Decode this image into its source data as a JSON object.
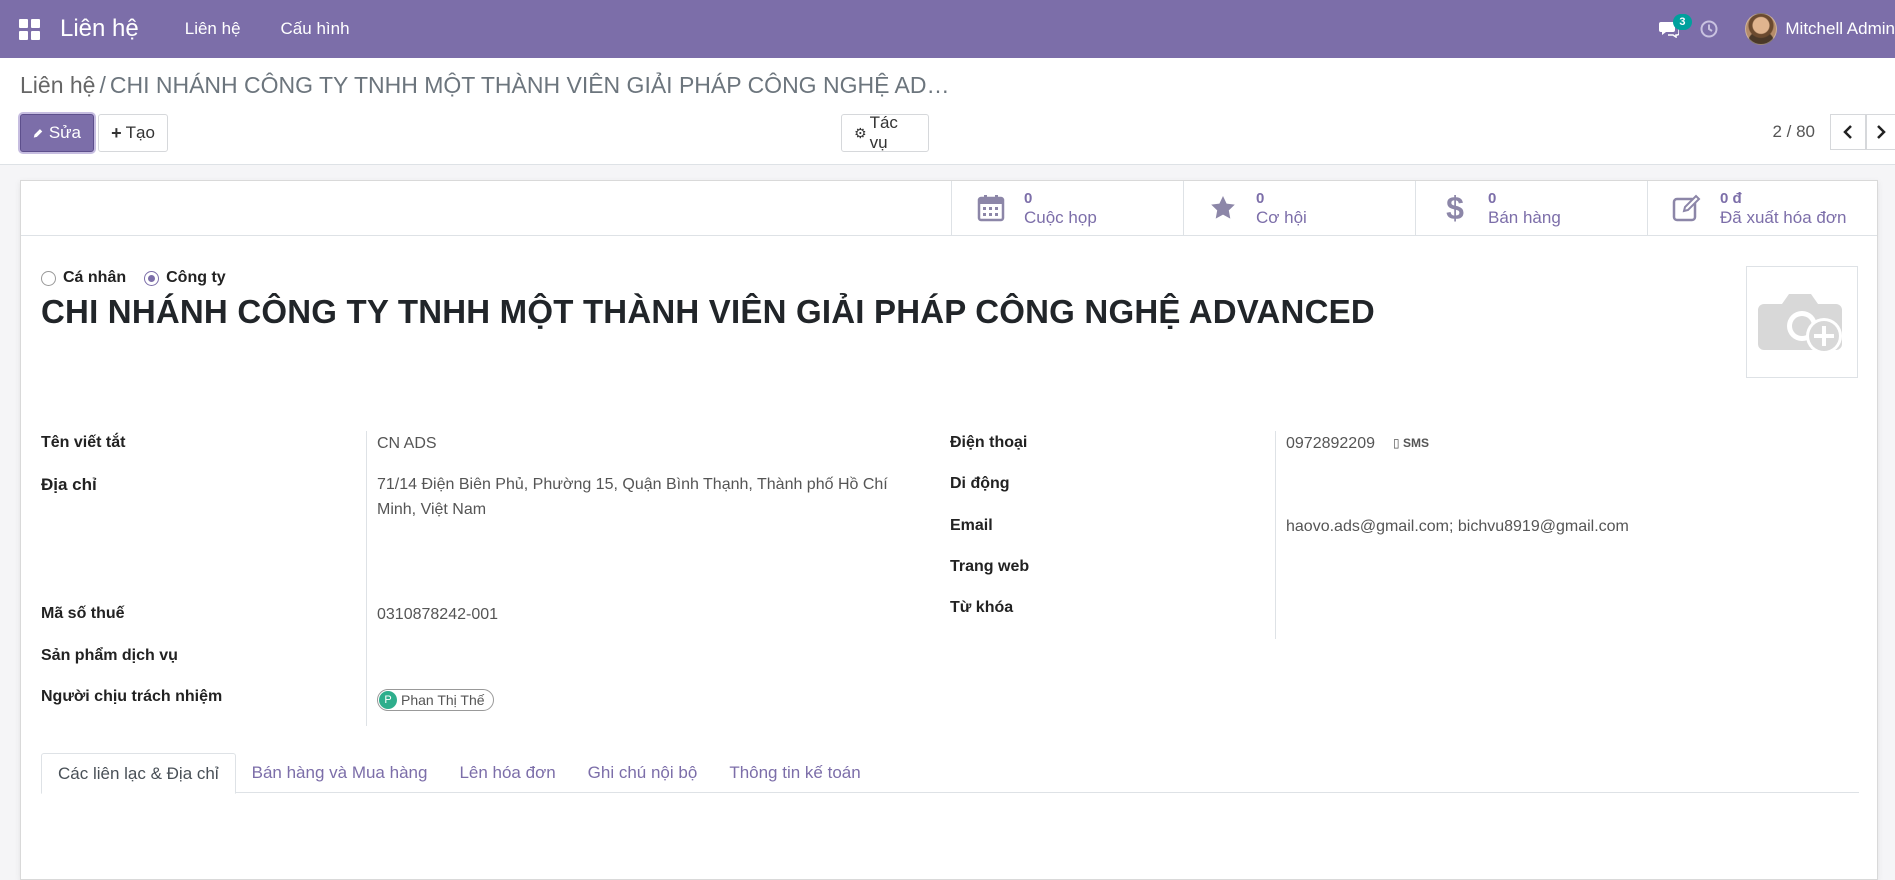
{
  "navbar": {
    "app_title": "Liên hệ",
    "menus": [
      "Liên hệ",
      "Cấu hình"
    ],
    "message_count": "3",
    "user_name": "Mitchell Admin"
  },
  "breadcrumb": {
    "parent": "Liên hệ",
    "separator": "/",
    "current": "CHI NHÁNH CÔNG TY TNHH MỘT THÀNH VIÊN GIẢI PHÁP CÔNG NGHỆ AD…"
  },
  "toolbar": {
    "edit_label": "Sửa",
    "create_label": "Tạo",
    "action_label": "Tác vụ",
    "pager": "2 / 80"
  },
  "smart_buttons": [
    {
      "value": "0",
      "label": "Cuộc họp",
      "icon": "calendar-icon"
    },
    {
      "value": "0",
      "label": "Cơ hội",
      "icon": "star-icon"
    },
    {
      "value": "0",
      "label": "Bán hàng",
      "icon": "dollar-icon"
    },
    {
      "value": "0 đ",
      "label": "Đã xuất hóa đơn",
      "icon": "edit-icon"
    }
  ],
  "company_type": {
    "individual_label": "Cá nhân",
    "company_label": "Công ty",
    "selected": "Công ty"
  },
  "record_title": "CHI NHÁNH CÔNG TY TNHH MỘT THÀNH VIÊN GIẢI PHÁP CÔNG NGHỆ ADVANCED",
  "left_fields": {
    "short_name_label": "Tên viết tắt",
    "short_name_value": "CN ADS",
    "address_label": "Địa chỉ",
    "address_value": "71/14 Điện Biên Phủ, Phường 15, Quận Bình Thạnh, Thành phố Hồ Chí Minh, Việt Nam",
    "tax_label": "Mã số thuế",
    "tax_value": "0310878242-001",
    "service_label": "Sản phẩm dịch vụ",
    "responsible_label": "Người chịu trách nhiệm",
    "responsible_initial": "P",
    "responsible_value": "Phan Thị Thế"
  },
  "right_fields": {
    "phone_label": "Điện thoại",
    "phone_value": "0972892209",
    "sms_label": "SMS",
    "mobile_label": "Di động",
    "email_label": "Email",
    "email_value": "haovo.ads@gmail.com; bichvu8919@gmail.com",
    "website_label": "Trang web",
    "tags_label": "Từ khóa"
  },
  "tabs": [
    "Các liên lạc & Địa chỉ",
    "Bán hàng và Mua hàng",
    "Lên hóa đơn",
    "Ghi chú nội bộ",
    "Thông tin kế toán"
  ],
  "colors": {
    "brand": "#7c6ea9",
    "tag_avatar": "#2eae8c",
    "badge": "#00a09d"
  }
}
